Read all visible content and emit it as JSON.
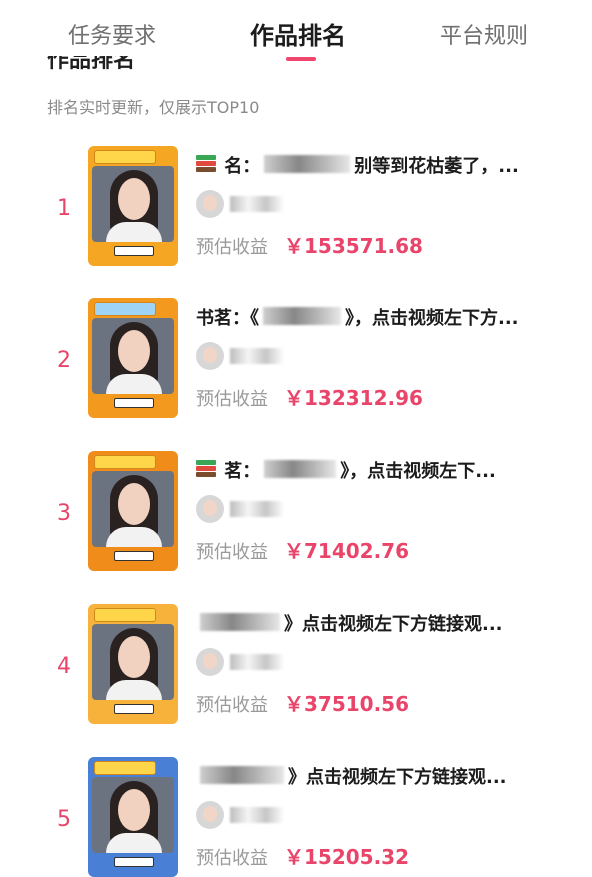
{
  "tabs": [
    {
      "label": "任务要求"
    },
    {
      "label": "作品排名"
    },
    {
      "label": "平台规则"
    }
  ],
  "section": {
    "title": "作品排名",
    "subtitle": "排名实时更新，仅展示TOP10"
  },
  "earn_label": "预估收益",
  "items": [
    {
      "rank": "1",
      "title_prefix": "名：",
      "title": "别等到花枯萎了，...",
      "earnings": "￥153571.68",
      "thumb_color": "#f5a623",
      "banner_color": "#ffd54a",
      "has_book_icon": true
    },
    {
      "rank": "2",
      "title_prefix": "书茗：《",
      "title": "》，点击视频左下方...",
      "earnings": "￥132312.96",
      "thumb_color": "#f39a1e",
      "banner_color": "#9fd3f5",
      "has_book_icon": false
    },
    {
      "rank": "3",
      "title_prefix": "茗：",
      "title": "》，点击视频左下...",
      "earnings": "￥71402.76",
      "thumb_color": "#f08c1a",
      "banner_color": "#ffd54a",
      "has_book_icon": true
    },
    {
      "rank": "4",
      "title_prefix": "",
      "title": "》点击视频左下方链接观...",
      "earnings": "￥37510.56",
      "thumb_color": "#f6b23a",
      "banner_color": "#ffd54a",
      "has_book_icon": false
    },
    {
      "rank": "5",
      "title_prefix": "",
      "title": "》点击视频左下方链接观...",
      "earnings": "￥15205.32",
      "thumb_color": "#4a7fd6",
      "banner_color": "#ffd54a",
      "has_book_icon": false
    }
  ]
}
